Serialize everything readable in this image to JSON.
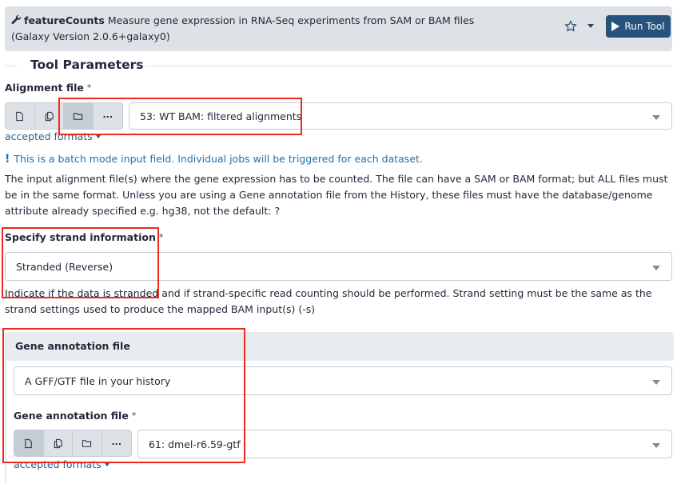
{
  "header": {
    "tool_name": "featureCounts",
    "tool_description": "Measure gene expression in RNA-Seq experiments from SAM or BAM files",
    "version": "(Galaxy Version 2.0.6+galaxy0)",
    "run_label": "Run Tool",
    "icons": {
      "tool": "wrench-icon",
      "favorite": "star-icon",
      "options": "caret-down-icon",
      "run": "play-icon"
    }
  },
  "section": {
    "title": "Tool Parameters"
  },
  "alignment": {
    "label": "Alignment file",
    "required_mark": "*",
    "modes": [
      {
        "icon": "file-icon",
        "active": false
      },
      {
        "icon": "files-icon",
        "active": false
      },
      {
        "icon": "folder-icon",
        "active": true
      },
      {
        "icon": "more-icon",
        "label": "..."
      }
    ],
    "selected": "53: WT BAM: filtered alignments",
    "accepted_formats": "accepted formats",
    "batch_notice": "This is a batch mode input field. Individual jobs will be triggered for each dataset.",
    "help": "The input alignment file(s) where the gene expression has to be counted. The file can have a SAM or BAM format; but ALL files must be in the same format. Unless you are using a Gene annotation file from the History, these files must have the database/genome attribute already specified e.g. hg38, not the default: ?"
  },
  "strand": {
    "label": "Specify strand information",
    "required_mark": "*",
    "selected": "Stranded (Reverse)",
    "help": "Indicate if the data is stranded and if strand-specific read counting should be performed. Strand setting must be the same as the strand settings used to produce the mapped BAM input(s) (-s)"
  },
  "annotation": {
    "section_title": "Gene annotation file",
    "source_selected": "A GFF/GTF file in your history",
    "file_label": "Gene annotation file",
    "required_mark": "*",
    "modes": [
      {
        "icon": "file-icon",
        "active": true
      },
      {
        "icon": "files-icon",
        "active": false
      },
      {
        "icon": "folder-icon",
        "active": false
      },
      {
        "icon": "more-icon",
        "label": "..."
      }
    ],
    "selected": "61: dmel-r6.59-gtf",
    "accepted_formats": "accepted formats"
  },
  "colors": {
    "primary": "#25537b",
    "header_bg": "#dee2e6",
    "highlight": "#ee2a1f",
    "info_text": "#2170ad",
    "link": "#2c5f8a"
  }
}
